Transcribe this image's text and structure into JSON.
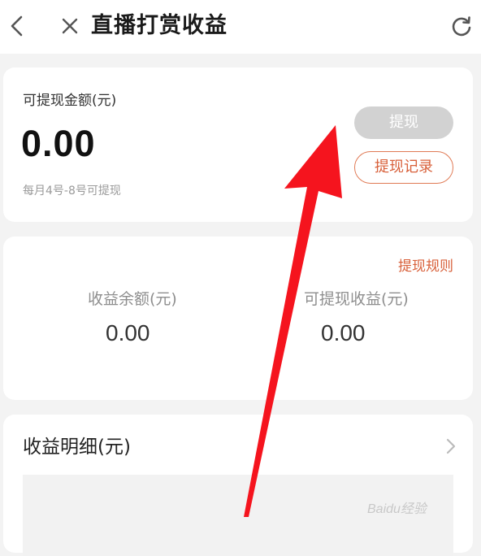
{
  "header": {
    "title": "直播打赏收益",
    "back_icon": "chevron-left-icon",
    "close_icon": "close-icon",
    "refresh_icon": "refresh-icon"
  },
  "withdraw_card": {
    "label": "可提现金额(元)",
    "amount": "0.00",
    "hint": "每月4号-8号可提现",
    "withdraw_button": "提现",
    "record_button": "提现记录"
  },
  "income_card": {
    "rules_link": "提现规则",
    "balance_label": "收益余额(元)",
    "balance_value": "0.00",
    "withdrawable_label": "可提现收益(元)",
    "withdrawable_value": "0.00"
  },
  "detail_card": {
    "title": "收益明细(元)"
  },
  "watermark": {
    "text": "Baidu经验"
  },
  "colors": {
    "accent": "#d8603a",
    "disabled_button": "#d2d2d2",
    "annotation_arrow": "#f5141e",
    "background": "#f3f3f3"
  }
}
